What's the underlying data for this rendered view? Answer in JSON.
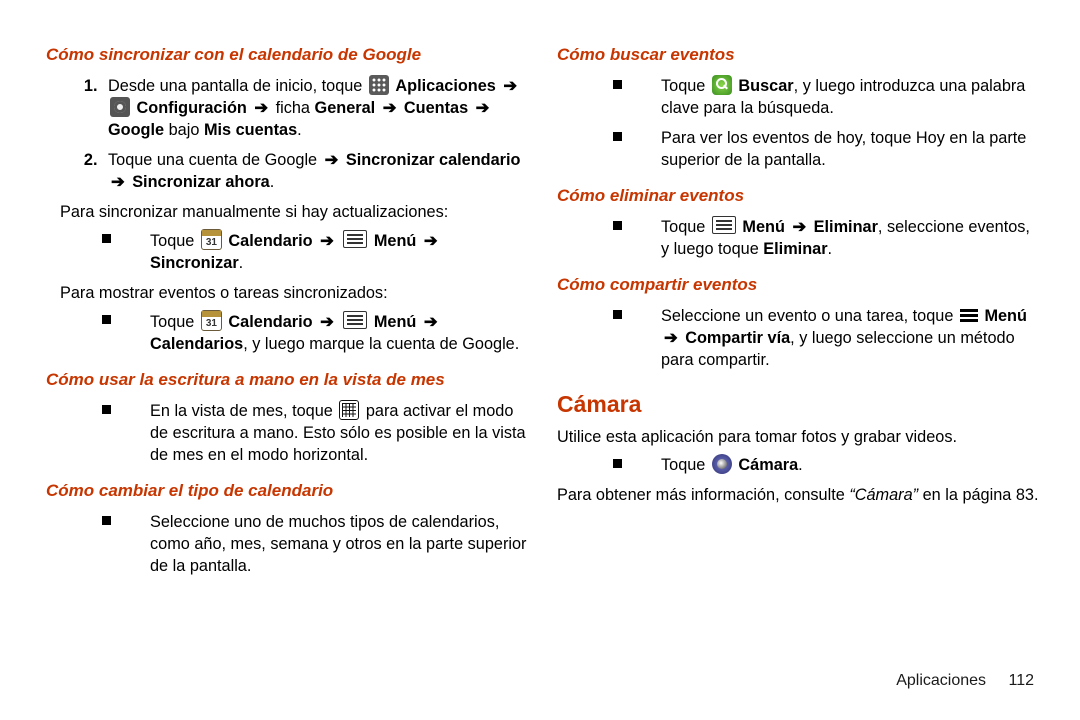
{
  "left": {
    "h_sync": "Cómo sincronizar con el calendario de Google",
    "ol1_a": "Desde una pantalla de inicio, toque ",
    "aplicaciones": "Aplicaciones",
    "config": "Configuración",
    "ficha": "ficha",
    "general": "General",
    "cuentas": "Cuentas",
    "google": "Google",
    "bajo": "bajo",
    "miscuentas": "Mis cuentas",
    "ol2_a": "Toque una cuenta de Google ",
    "sync_cal": "Sincronizar calendario",
    "sync_now": "Sincronizar ahora",
    "p1": "Para sincronizar manualmente si hay actualizaciones:",
    "toque": "Toque",
    "calendario": "Calendario",
    "menu": "Menú",
    "sincronizar": "Sincronizar",
    "p2": "Para mostrar eventos o tareas sincronizados:",
    "calendarios": "Calendarios",
    "y_luego": ", y luego marque la cuenta de Google.",
    "h_hand": "Cómo usar la escritura a mano en la vista de mes",
    "hand_a": "En la vista de mes, toque ",
    "hand_b": " para activar el modo de escritura a mano. Esto sólo es posible en la vista de mes en el modo horizontal.",
    "h_type": "Cómo cambiar el tipo de calendario",
    "type_t": "Seleccione uno de muchos tipos de calendarios, como año, mes, semana y otros en la parte superior de la pantalla."
  },
  "right": {
    "h_search": "Cómo buscar eventos",
    "toque": "Toque",
    "buscar": "Buscar",
    "search_b": ", y luego introduzca una palabra clave para la búsqueda.",
    "search2": "Para ver los eventos de hoy, toque Hoy en la parte superior de la pantalla.",
    "h_del": "Cómo eliminar eventos",
    "menu": "Menú",
    "eliminar": "Eliminar",
    "del_b": ", seleccione eventos, y luego toque ",
    "h_share": "Cómo compartir eventos",
    "share_a": "Seleccione un evento o una tarea, toque ",
    "compartir": "Compartir vía",
    "share_b": ", y luego seleccione un método para compartir.",
    "h_cam": "Cámara",
    "cam_p": "Utilice esta aplicación para tomar fotos y grabar videos.",
    "camara": "Cámara",
    "cam_info_a": "Para obtener más información, consulte ",
    "cam_q": "“Cámara”",
    "cam_info_b": " en la página 83."
  },
  "footer": {
    "section": "Aplicaciones",
    "page": "112"
  },
  "arrow": "➔",
  "dot": "."
}
